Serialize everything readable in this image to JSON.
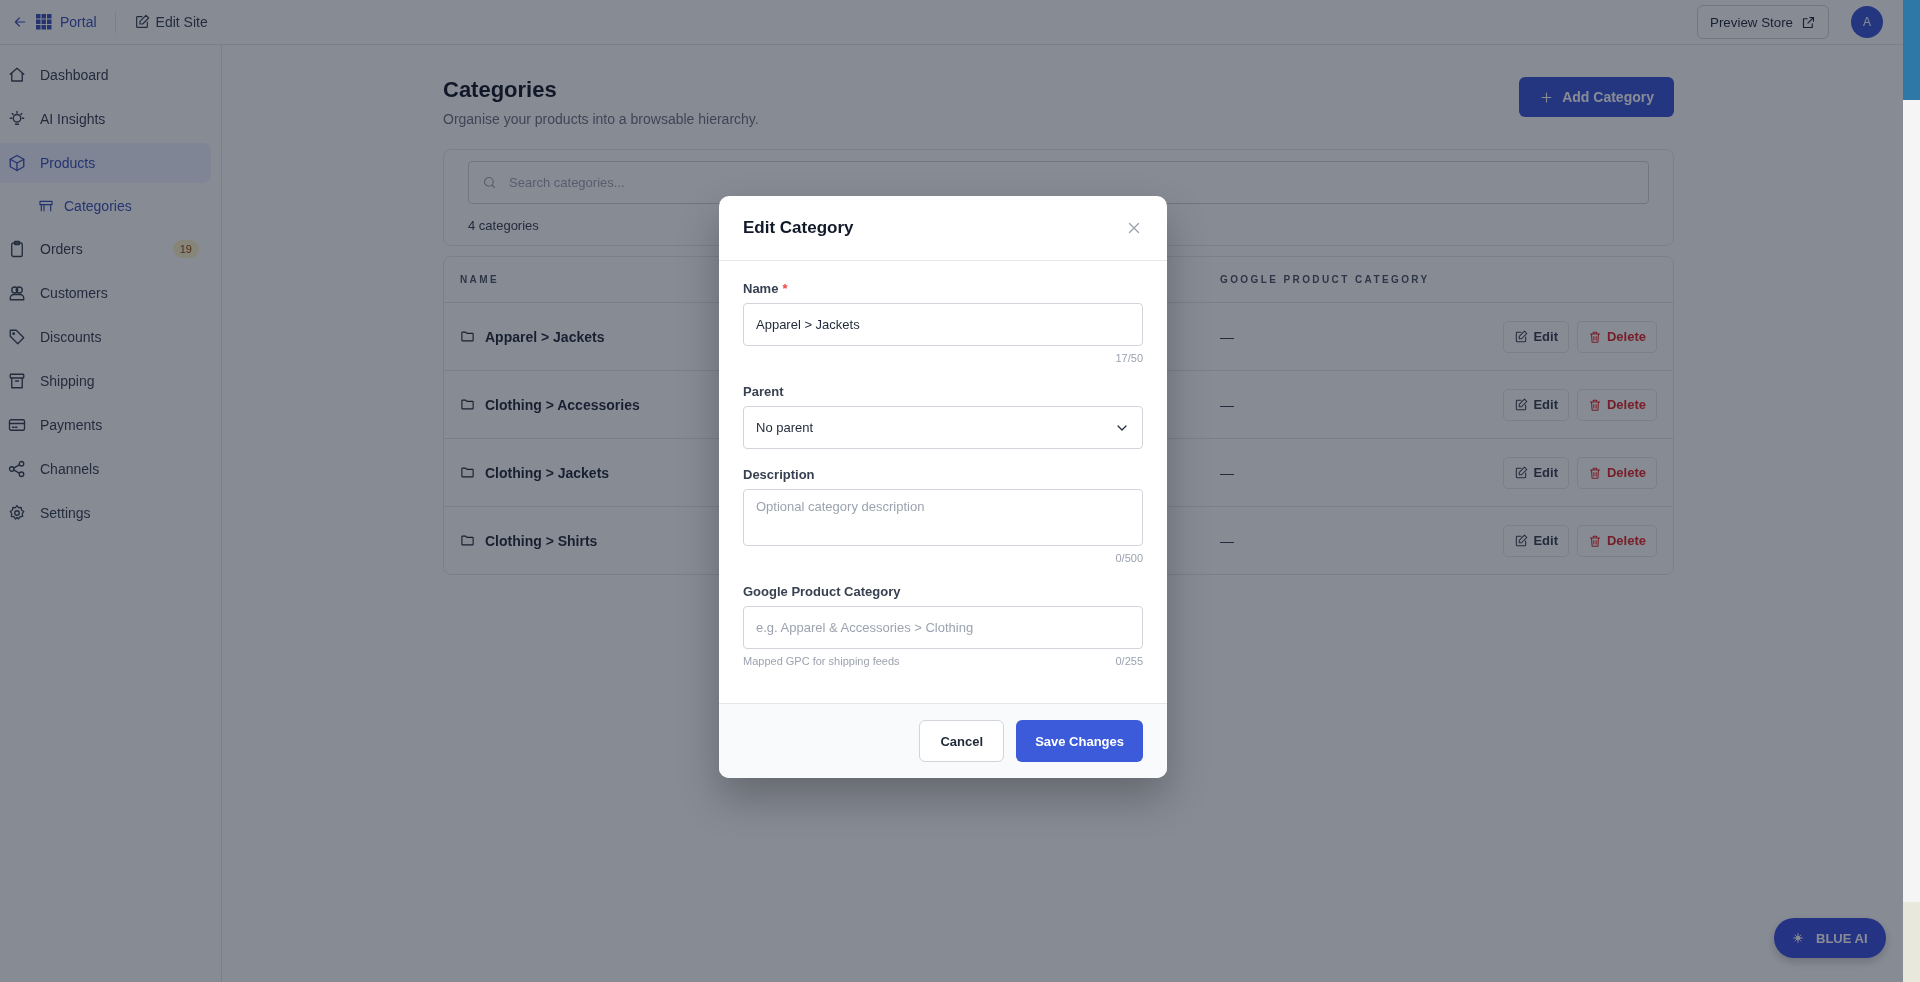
{
  "topbar": {
    "back_label": "Portal",
    "edit_label": "Edit Site",
    "preview_button": "Preview Store",
    "avatar": "A"
  },
  "sidebar": {
    "items": [
      {
        "label": "Dashboard",
        "selected": false
      },
      {
        "label": "AI Insights",
        "selected": false
      },
      {
        "label": "Products",
        "selected": true,
        "children": [
          {
            "label": "Categories",
            "selected": true
          }
        ]
      },
      {
        "label": "Orders",
        "selected": false,
        "badge": "19"
      },
      {
        "label": "Customers",
        "selected": false
      },
      {
        "label": "Discounts",
        "selected": false
      },
      {
        "label": "Shipping",
        "selected": false
      },
      {
        "label": "Payments",
        "selected": false
      },
      {
        "label": "Channels",
        "selected": false
      },
      {
        "label": "Settings",
        "selected": false
      }
    ]
  },
  "page": {
    "title": "Categories",
    "subtitle": "Organise your products into a browsable hierarchy.",
    "add_button": "Add Category",
    "search": {
      "placeholder": "Search categories..."
    },
    "count": "4 categories",
    "table": {
      "columns": [
        "NAME",
        "GOOGLE PRODUCT CATEGORY"
      ],
      "rows": [
        {
          "name": "Apparel > Jackets",
          "google_category": "—",
          "edit": "Edit",
          "delete": "Delete"
        },
        {
          "name": "Clothing > Accessories",
          "google_category": "—",
          "edit": "Edit",
          "delete": "Delete"
        },
        {
          "name": "Clothing > Jackets",
          "google_category": "—",
          "edit": "Edit",
          "delete": "Delete"
        },
        {
          "name": "Clothing > Shirts",
          "google_category": "—",
          "edit": "Edit",
          "delete": "Delete"
        }
      ]
    }
  },
  "modal": {
    "title": "Edit Category",
    "fields": [
      {
        "kind": "text",
        "label": "Name",
        "required_mark": "*",
        "value": "Apparel > Jackets",
        "counter": "17/50"
      },
      {
        "kind": "select",
        "label": "Parent",
        "value": "No parent"
      },
      {
        "kind": "textarea",
        "label": "Description",
        "placeholder": "Optional category description",
        "counter": "0/500"
      },
      {
        "kind": "text",
        "label": "Google Product Category",
        "placeholder": "e.g. Apparel & Accessories > Clothing",
        "hint": "Mapped GPC for shipping feeds",
        "counter": "0/255"
      }
    ],
    "cancel_button": "Cancel",
    "save_button": "Save Changes"
  },
  "ai_button": "BLUE AI"
}
